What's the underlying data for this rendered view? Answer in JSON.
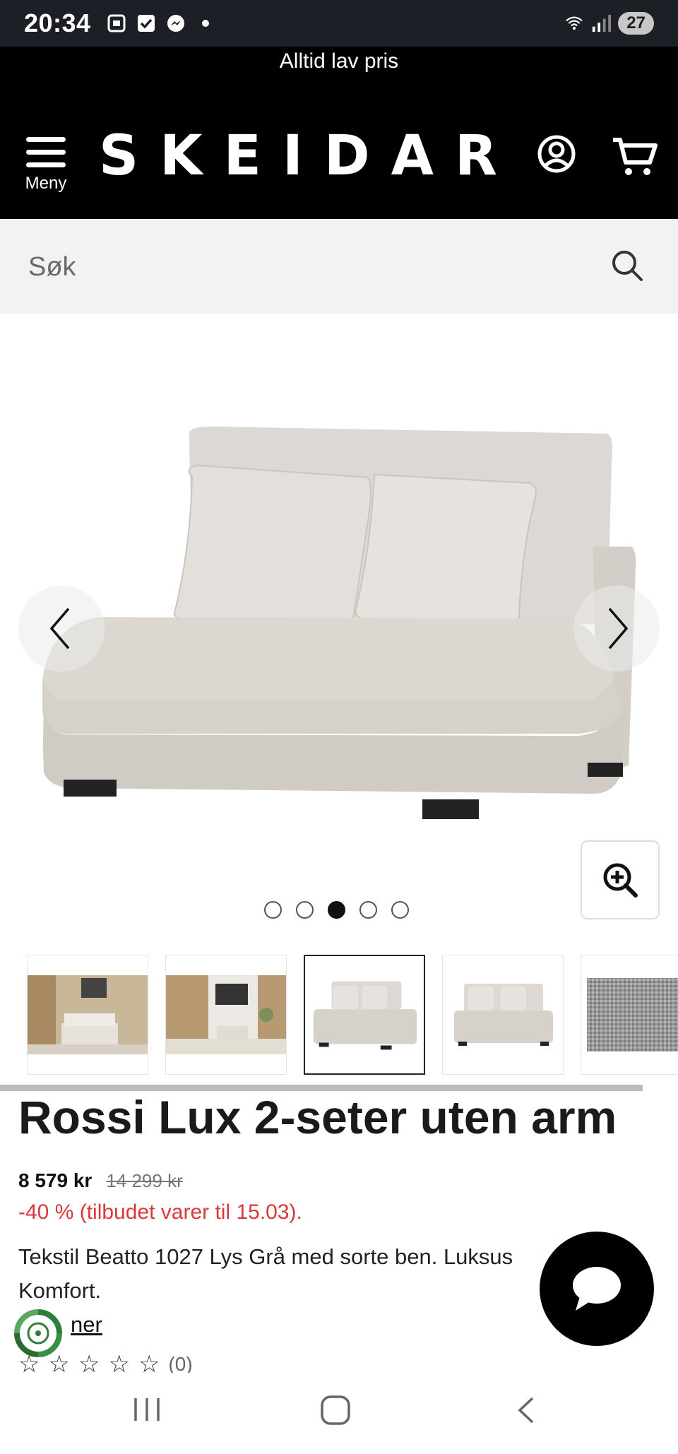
{
  "status_bar": {
    "time": "20:34",
    "battery": "27",
    "icons": [
      "screenshot-icon",
      "checkbox-icon",
      "messenger-icon",
      "dot-icon",
      "wifi-icon",
      "signal-icon"
    ]
  },
  "header": {
    "promo": "Alltid lav pris",
    "menu_label": "Meny",
    "logo": "SKEIDAR"
  },
  "search": {
    "placeholder": "Søk"
  },
  "gallery": {
    "dot_count": 5,
    "active_dot": 3,
    "thumbnails": [
      "room-scene-1",
      "room-scene-2",
      "sofa-front",
      "sofa-angle",
      "fabric-swatch"
    ],
    "active_thumbnail": 3
  },
  "product": {
    "title": "Rossi Lux 2-seter uten arm",
    "price": "8 579 kr",
    "old_price": "14 299 kr",
    "discount": "-40 % (tilbudet varer til 15.03).",
    "description": "Tekstil Beatto 1027 Lys Grå med sorte ben. Luksus Komfort.",
    "link": "ner",
    "rating_count": "(0)"
  },
  "colors": {
    "header_bg": "#000000",
    "status_bg": "#1d1f26",
    "search_bg": "#f2f2f2",
    "discount": "#d9393a",
    "fabric": "#ddd8d3"
  }
}
